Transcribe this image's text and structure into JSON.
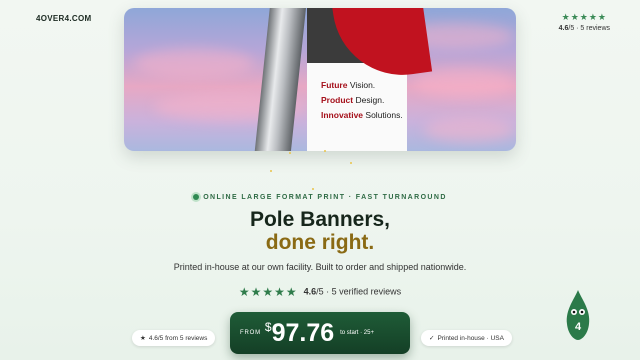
{
  "logo": "4OVER4.COM",
  "top_rating": {
    "stars": "★★★★★",
    "score": "4.6",
    "text": "/5 · 5 reviews"
  },
  "hero": {
    "banner_lines": [
      {
        "accent": "Future",
        "rest": " Vision."
      },
      {
        "accent": "Product",
        "rest": " Design."
      },
      {
        "accent": "Innovative",
        "rest": " Solutions."
      }
    ]
  },
  "eyebrow": "ONLINE LARGE FORMAT PRINT · FAST TURNAROUND",
  "title": {
    "line1": "Pole Banners,",
    "line2": "done right."
  },
  "subtitle": "Printed in-house at our own facility. Built to order and shipped nationwide.",
  "rating": {
    "stars": "★★★★★",
    "score": "4.6",
    "rest": "/5 · 5 verified reviews"
  },
  "pill_left": {
    "icon": "★",
    "text": "4.6/5 from 5 reviews"
  },
  "pill_right": {
    "icon": "✓",
    "text": "Printed in-house · USA"
  },
  "price": {
    "from": "FROM",
    "currency": "$",
    "amount": "97.76",
    "note": "to start · 25+"
  },
  "mascot": {
    "label": "4"
  },
  "colors": {
    "brand_green": "#1f5c37",
    "accent_gold": "#8a6a14",
    "banner_red": "#c1121f"
  }
}
